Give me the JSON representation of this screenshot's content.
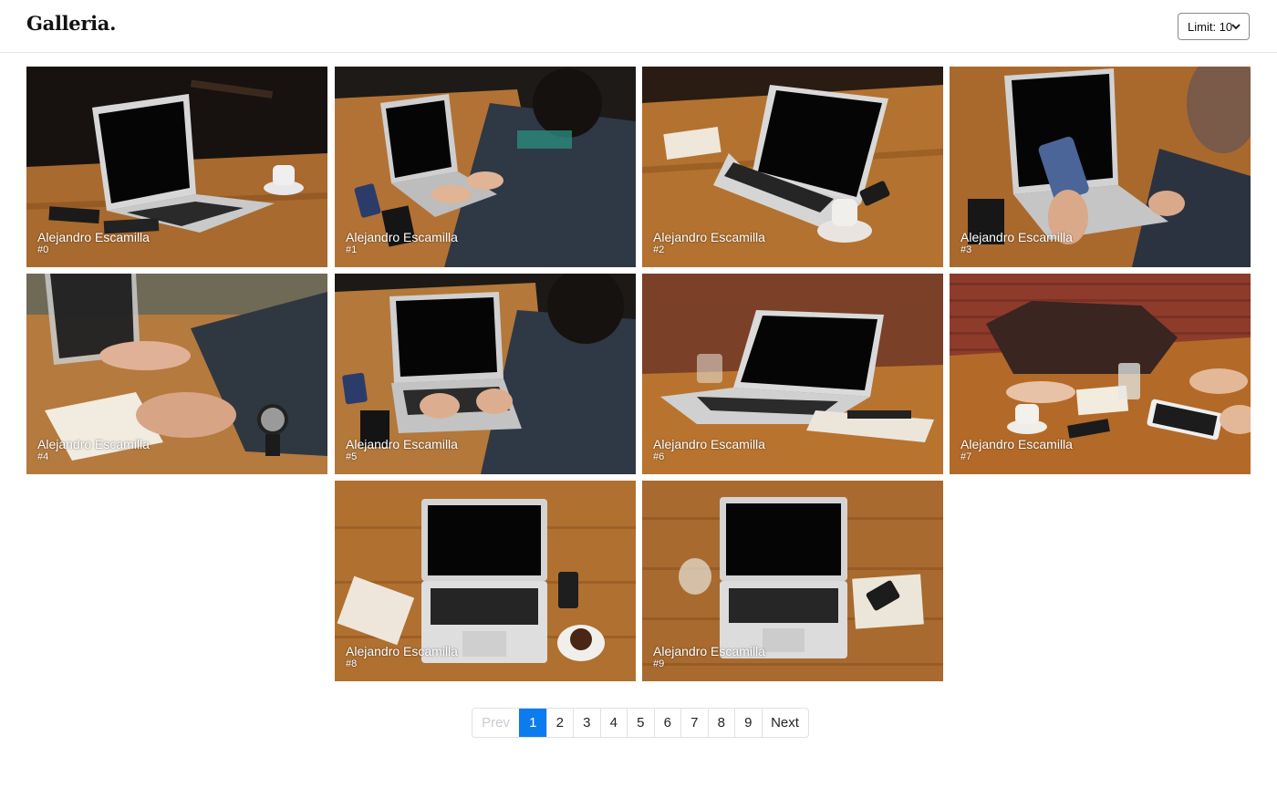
{
  "header": {
    "brand": "Galleria.",
    "limit_label": "Limit: 10"
  },
  "gallery": {
    "photos": [
      {
        "author": "Alejandro Escamilla",
        "number": "#0"
      },
      {
        "author": "Alejandro Escamilla",
        "number": "#1"
      },
      {
        "author": "Alejandro Escamilla",
        "number": "#2"
      },
      {
        "author": "Alejandro Escamilla",
        "number": "#3"
      },
      {
        "author": "Alejandro Escamilla",
        "number": "#4"
      },
      {
        "author": "Alejandro Escamilla",
        "number": "#5"
      },
      {
        "author": "Alejandro Escamilla",
        "number": "#6"
      },
      {
        "author": "Alejandro Escamilla",
        "number": "#7"
      },
      {
        "author": "Alejandro Escamilla",
        "number": "#8"
      },
      {
        "author": "Alejandro Escamilla",
        "number": "#9"
      }
    ]
  },
  "pagination": {
    "prev_label": "Prev",
    "next_label": "Next",
    "pages": [
      "1",
      "2",
      "3",
      "4",
      "5",
      "6",
      "7",
      "8",
      "9"
    ],
    "current": "1"
  },
  "colors": {
    "accent": "#0b7cf0",
    "wood": "#a8652a",
    "dark_bg": "#1a1512"
  }
}
